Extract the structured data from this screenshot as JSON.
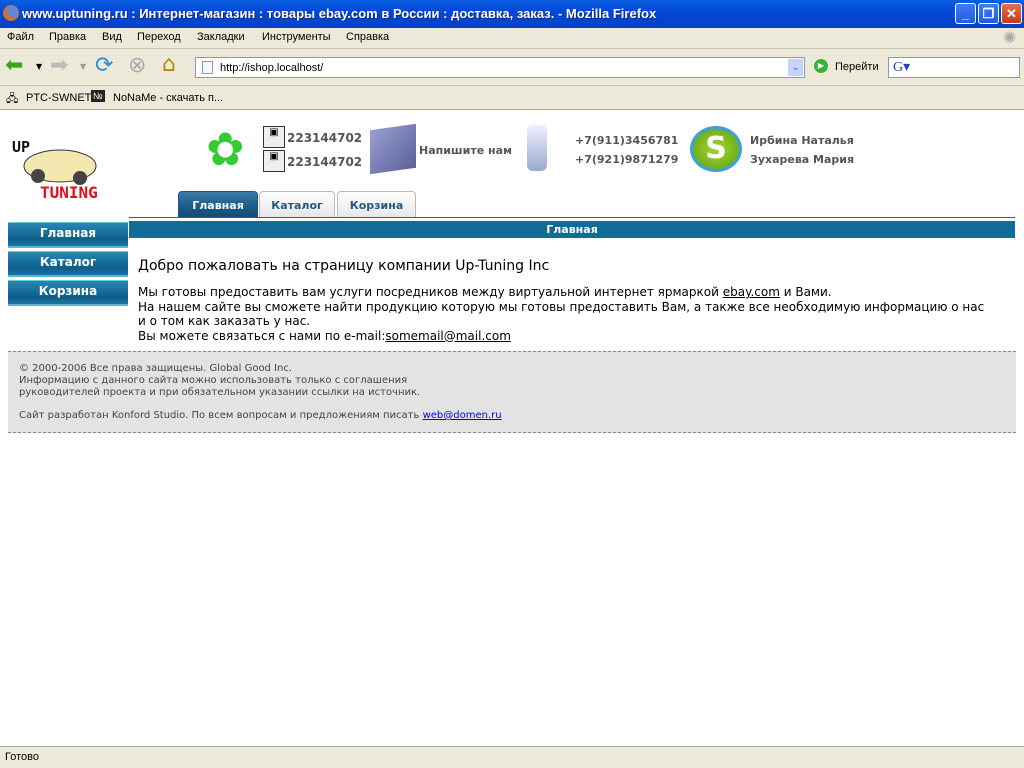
{
  "window": {
    "title": "www.uptuning.ru : Интернет-магазин : товары ebay.com в России : доставка, заказ. - Mozilla Firefox"
  },
  "menu": [
    "Файл",
    "Правка",
    "Вид",
    "Переход",
    "Закладки",
    "Инструменты",
    "Справка"
  ],
  "toolbar": {
    "url": "http://ishop.localhost/",
    "go_label": "Перейти"
  },
  "bookmarks": [
    "PTC-SWNET",
    "NoNaMe - скачать п..."
  ],
  "header": {
    "icq": [
      "223144702",
      "223144702"
    ],
    "write_us": "Напишите нам",
    "phones": [
      "+7(911)3456781",
      "+7(921)9871279"
    ],
    "skype": [
      "Ирбина Наталья",
      "Зухарева Мария"
    ]
  },
  "tabs": [
    "Главная",
    "Каталог",
    "Корзина"
  ],
  "sidenav": [
    "Главная",
    "Каталог",
    "Корзина"
  ],
  "section_title": "Главная",
  "content": {
    "heading": "Добро пожаловать на страницу компании Up-Tuning Inc",
    "line1_pre": "Мы готовы предоставить вам услуги посредников между виртуальной интернет ярмаркой ",
    "line1_link": "ebay.com",
    "line1_post": " и Вами.",
    "line2": "На нашем сайте вы сможете найти продукцию которую мы готовы предоставить Вам, а также все необходимую информацию о нас",
    "line3": "и о том как заказать у нас.",
    "line4_pre": "Вы можете связаться с нами по e-mail:",
    "line4_link": "somemail@mail.com"
  },
  "footer": {
    "copyright": "© 2000-2006 Все права защищены. Global Good Inc.",
    "info1": "Информацию с данного сайта можно использовать только с соглашения",
    "info2": "руководителей проекта и при обязательном указании ссылки на источник.",
    "dev": "Сайт разработан Konford Studio. По всем вопросам и предложениям писать ",
    "dev_link": "web@domen.ru"
  },
  "status": "Готово"
}
